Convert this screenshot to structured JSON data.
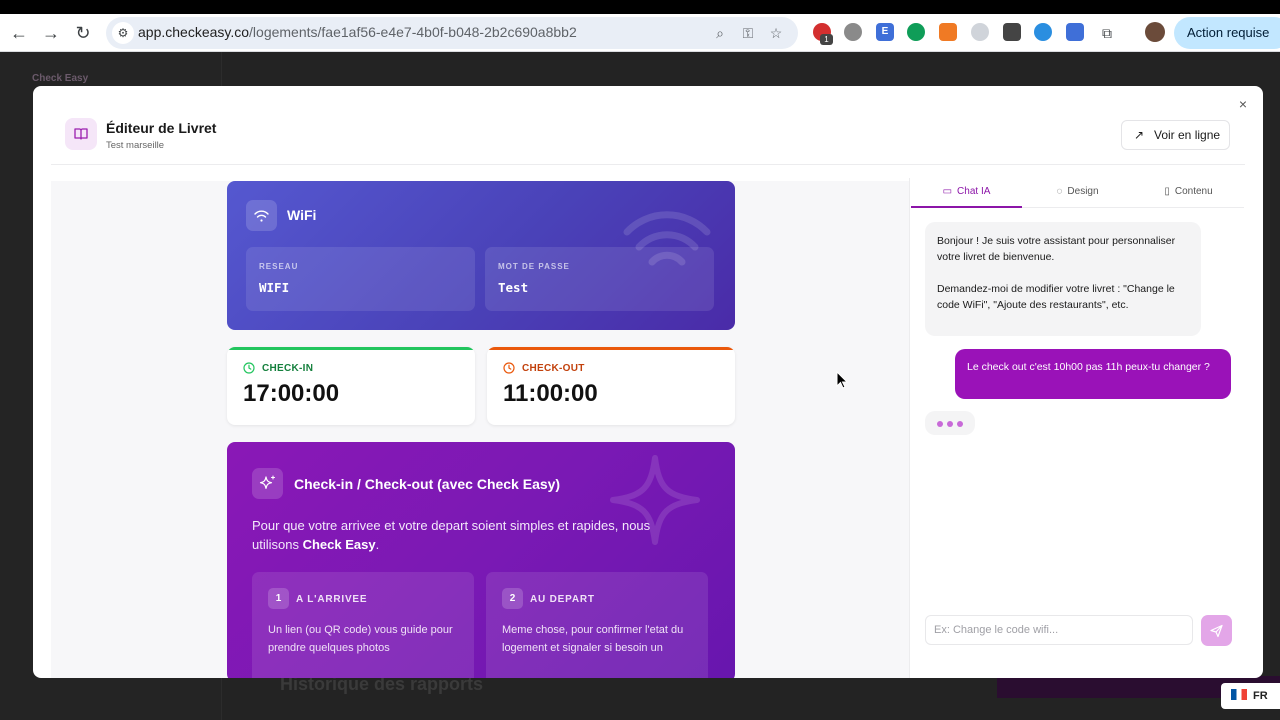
{
  "browser": {
    "url_host": "app.checkeasy.co",
    "url_path": "/logements/fae1af56-e4e7-4b0f-b048-2b2c690a8bb2",
    "extension_badge": "1",
    "action_button": "Action requise"
  },
  "background": {
    "logo_text": "Check Easy",
    "history_title": "Historique des rapports",
    "language": "FR"
  },
  "modal": {
    "title": "Éditeur de Livret",
    "subtitle": "Test marseille",
    "view_online": "Voir en ligne",
    "close": "×"
  },
  "wifi": {
    "title": "WiFi",
    "network_label": "RESEAU",
    "network_value": "WIFI",
    "password_label": "MOT DE PASSE",
    "password_value": "Test"
  },
  "checkin": {
    "label": "CHECK-IN",
    "time": "17:00:00",
    "color": "#22c55e"
  },
  "checkout": {
    "label": "CHECK-OUT",
    "time": "11:00:00",
    "color": "#ea580c"
  },
  "checkeasy_card": {
    "title": "Check-in / Check-out (avec Check Easy)",
    "desc_prefix": "Pour que votre arrivee et votre depart soient simples et rapides, nous utilisons ",
    "desc_brand": "Check Easy",
    "desc_suffix": ".",
    "steps": [
      {
        "num": "1",
        "title": "A L'ARRIVEE",
        "text": "Un lien (ou QR code) vous guide pour prendre quelques photos"
      },
      {
        "num": "2",
        "title": "AU DEPART",
        "text": "Meme chose, pour confirmer l'etat du logement et signaler si besoin un"
      }
    ]
  },
  "panel": {
    "tabs": [
      {
        "label": "Chat IA",
        "icon": "chat-icon",
        "active": true
      },
      {
        "label": "Design",
        "icon": "palette-icon",
        "active": false
      },
      {
        "label": "Contenu",
        "icon": "file-icon",
        "active": false
      }
    ],
    "bot_line1": "Bonjour ! Je suis votre assistant pour personnaliser votre livret de bienvenue.",
    "bot_line2": "Demandez-moi de modifier votre livret : \"Change le code WiFi\", \"Ajoute des restaurants\", etc.",
    "user_message": "Le check out c'est 10h00 pas 11h peux-tu changer ?",
    "input_placeholder": "Ex: Change le code wifi...",
    "accent": "#9a12b8"
  }
}
